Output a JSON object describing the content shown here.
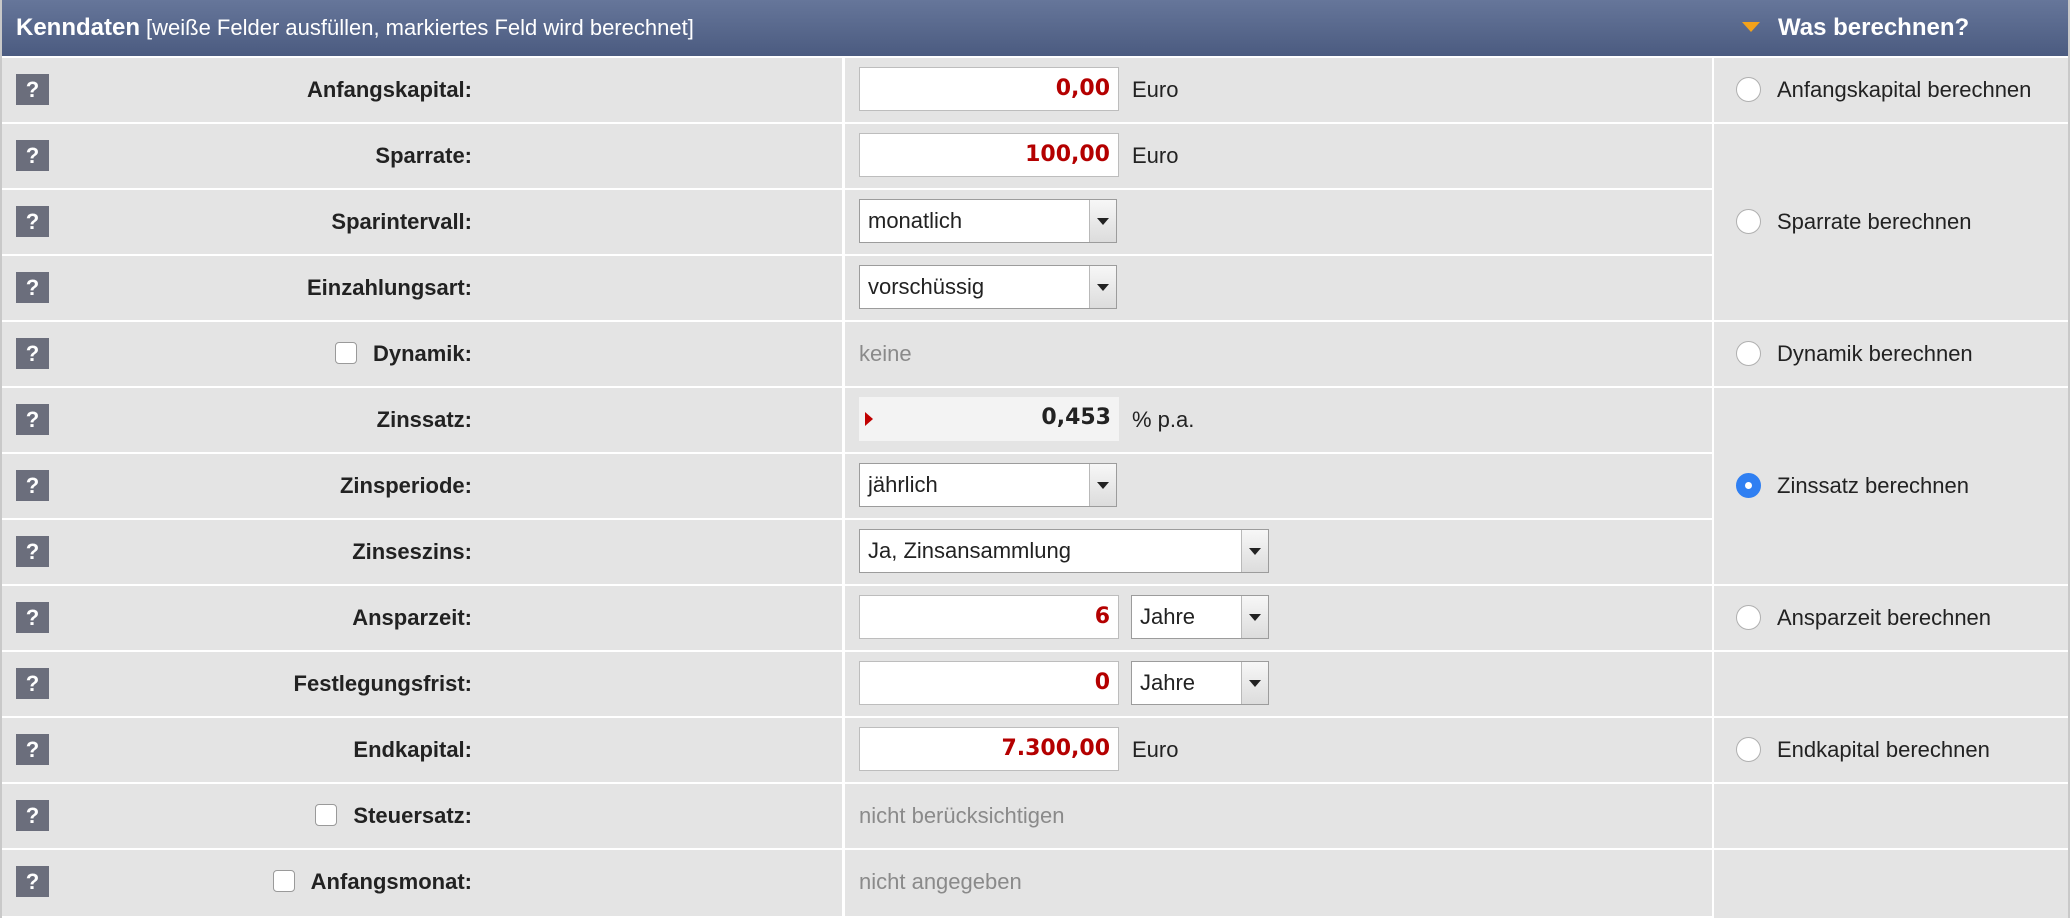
{
  "header": {
    "title": "Kenndaten",
    "subtitle": "[weiße Felder ausfüllen, markiertes Feld wird berechnet]",
    "right_title": "Was berechnen?",
    "accent_color": "#f3a21a"
  },
  "help_label": "?",
  "rows": {
    "anfangskapital": {
      "label": "Anfangskapital:",
      "value": "0,00",
      "unit": "Euro"
    },
    "sparrate": {
      "label": "Sparrate:",
      "value": "100,00",
      "unit": "Euro"
    },
    "sparintervall": {
      "label": "Sparintervall:",
      "selected": "monatlich"
    },
    "einzahlungsart": {
      "label": "Einzahlungsart:",
      "selected": "vorschüssig"
    },
    "dynamik": {
      "label": "Dynamik:",
      "checked": false,
      "value": "keine"
    },
    "zinssatz": {
      "label": "Zinssatz:",
      "value": "0,453",
      "unit": "% p.a."
    },
    "zinsperiode": {
      "label": "Zinsperiode:",
      "selected": "jährlich"
    },
    "zinseszins": {
      "label": "Zinseszins:",
      "selected": "Ja, Zinsansammlung"
    },
    "ansparzeit": {
      "label": "Ansparzeit:",
      "value": "6",
      "unit_selected": "Jahre"
    },
    "festlegungsfrist": {
      "label": "Festlegungsfrist:",
      "value": "0",
      "unit_selected": "Jahre"
    },
    "endkapital": {
      "label": "Endkapital:",
      "value": "7.300,00",
      "unit": "Euro"
    },
    "steuersatz": {
      "label": "Steuersatz:",
      "checked": false,
      "value": "nicht berücksichtigen"
    },
    "anfangsmonat": {
      "label": "Anfangsmonat:",
      "checked": false,
      "value": "nicht angegeben"
    }
  },
  "calc_options": [
    {
      "label": "Anfangskapital berechnen",
      "selected": false
    },
    {
      "label": "Sparrate berechnen",
      "selected": false
    },
    {
      "label": "Dynamik berechnen",
      "selected": false
    },
    {
      "label": "Zinssatz berechnen",
      "selected": true
    },
    {
      "label": "Ansparzeit berechnen",
      "selected": false
    },
    {
      "label": "Endkapital berechnen",
      "selected": false
    }
  ],
  "colors": {
    "input_value": "#b40000",
    "header_bg": "#56668c",
    "row_bg": "#e4e4e4",
    "radio_selected": "#2f7ff2"
  }
}
